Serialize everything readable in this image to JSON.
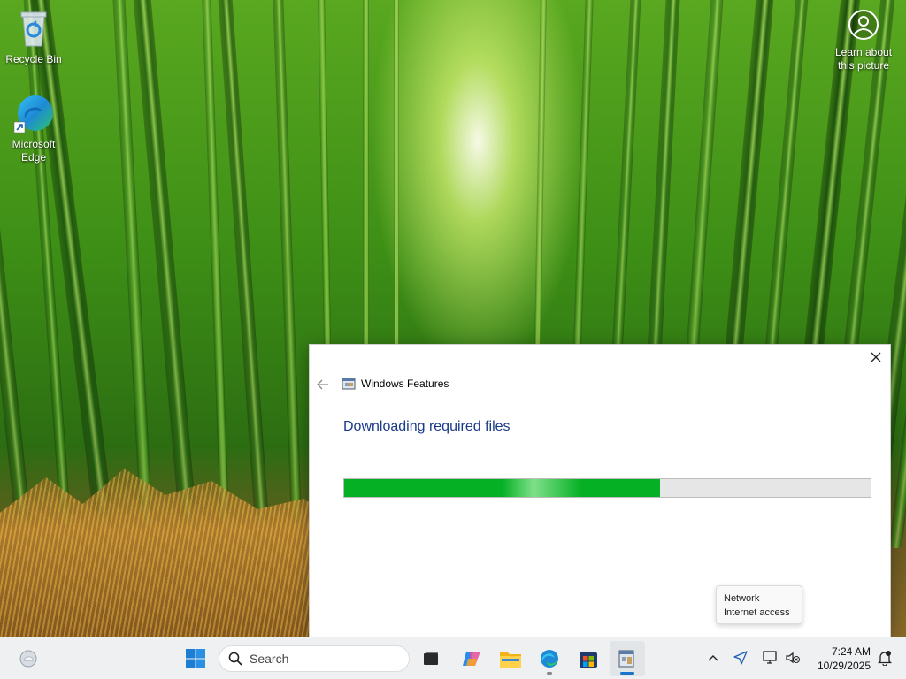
{
  "desktop": {
    "icons": [
      {
        "label": "Recycle Bin",
        "icon": "recycle-bin-icon"
      },
      {
        "label": "Microsoft Edge",
        "icon": "edge-icon"
      }
    ],
    "learn_picture": {
      "label_line1": "Learn about",
      "label_line2": "this picture",
      "icon": "person-circle-icon"
    }
  },
  "dialog": {
    "title": "Windows Features",
    "heading": "Downloading required files",
    "progress_percent": 60,
    "accent_color": "#06b025"
  },
  "tooltip": {
    "line1": "Network",
    "line2": "Internet access"
  },
  "taskbar": {
    "search_placeholder": "Search",
    "pinned": [
      "start-icon",
      "task-view-icon",
      "copilot-icon",
      "file-explorer-icon",
      "edge-icon",
      "store-icon",
      "windows-features-icon"
    ],
    "clock_time": "7:24 AM",
    "clock_date": "10/29/2025"
  }
}
